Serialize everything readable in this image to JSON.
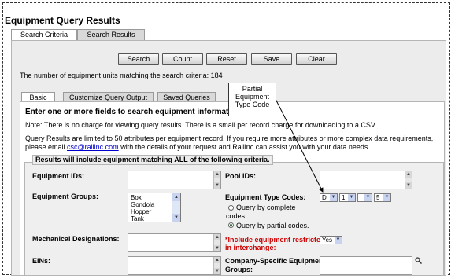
{
  "page": {
    "title": "Equipment Query Results",
    "tabs": [
      {
        "label": "Search Criteria",
        "active": true
      },
      {
        "label": "Search Results",
        "active": false
      }
    ]
  },
  "toolbar": {
    "search": "Search",
    "count": "Count",
    "reset": "Reset",
    "save": "Save",
    "clear": "Clear"
  },
  "count_message": "The number of equipment units matching the search criteria: 184",
  "subtabs": [
    {
      "label": "Basic",
      "active": true
    },
    {
      "label": "Customize Query Output",
      "active": false
    },
    {
      "label": "Saved Queries",
      "active": false
    }
  ],
  "callout": {
    "line1": "Partial",
    "line2": "Equipment",
    "line3": "Type Code"
  },
  "basic": {
    "heading": "Enter one or more fields to search equipment information.",
    "note": "Note: There is no charge for viewing query results. There is a small per record charge for downloading to a CSV.",
    "limit_line1": "Query Results are limited to 50 attributes per equipment record. If you require more attributes or more complex data requirements,",
    "limit_pre": "please email ",
    "limit_email": "csc@railinc.com",
    "limit_post": " with the details of your request and Railinc can assist you with your data needs.",
    "criteria_legend": "Results will include equipment matching ALL of the following criteria."
  },
  "fields": {
    "equipment_ids": "Equipment IDs:",
    "pool_ids": "Pool IDs:",
    "equipment_groups": "Equipment Groups:",
    "equipment_groups_options": [
      "Box",
      "Gondola",
      "Hopper",
      "Tank"
    ],
    "equipment_type_codes": "Equipment Type Codes:",
    "type_code_values": [
      "D",
      "1",
      "",
      "5"
    ],
    "radio_complete_line1": "Query by complete",
    "radio_complete_line2": "codes.",
    "radio_partial": "Query by partial codes.",
    "mechanical_designations": "Mechanical Designations:",
    "interchange_line1": "*Include equipment restricted",
    "interchange_line2": "in interchange:",
    "interchange_value": "Yes",
    "eins": "EINs:",
    "company_groups_line1": "Company-Specific Equipment",
    "company_groups_line2": "Groups:"
  },
  "colors": {
    "accent_red": "#cc0000",
    "link": "#0000cc",
    "panel": "#ececec"
  }
}
